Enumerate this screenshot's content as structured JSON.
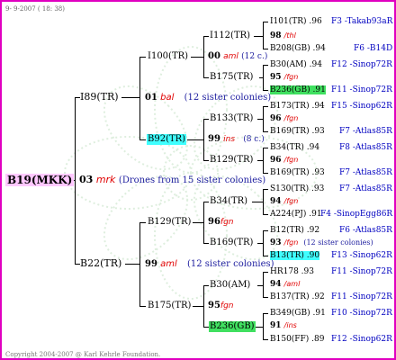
{
  "header": {
    "date": "9- 9-2007 ( 18: 38)"
  },
  "footer": {
    "copyright": "Copyright 2004-2007 @ Karl Kehrle Foundation."
  },
  "root": {
    "id": "B19(MKK)"
  },
  "gen1": [
    {
      "id": "I89(TR)"
    },
    {
      "year": "03",
      "fam": "mrk",
      "note": "(Drones from 15 sister colonies)"
    },
    {
      "id": "B22(TR)"
    }
  ],
  "gen2": [
    {
      "id": "I100(TR)"
    },
    {
      "year": "01",
      "fam": "bal",
      "note": "(12 sister colonies)"
    },
    {
      "id": "B92(TR)"
    },
    {
      "id": "B129(TR)"
    },
    {
      "year": "99",
      "fam": "aml",
      "note": "(12 sister colonies)"
    },
    {
      "id": "B175(TR)"
    }
  ],
  "gen3": [
    {
      "id": "I112(TR)"
    },
    {
      "year": "00",
      "fam": "aml",
      "note": "(12 c.)"
    },
    {
      "id": "B175(TR)"
    },
    {
      "id": "B133(TR)"
    },
    {
      "year": "99",
      "fam": "ins",
      "note": "(8 c.)"
    },
    {
      "id": "B129(TR)"
    },
    {
      "id": "B34(TR)"
    },
    {
      "year": "96",
      "fam": "fgn"
    },
    {
      "id": "B169(TR)"
    },
    {
      "id": "B30(AM)"
    },
    {
      "year": "95",
      "fam": "fgn"
    },
    {
      "id": "B236(GB)"
    }
  ],
  "gen4": [
    {
      "id": "I101(TR)",
      "score": ".96",
      "ped": "F3 -Takab93aR"
    },
    {
      "year": "98",
      "fam": "/thl"
    },
    {
      "id": "B208(GB)",
      "score": ".94",
      "ped": "F6 -B14D"
    },
    {
      "id": "B30(AM)",
      "score": ".94",
      "ped": "F12 -Sinop72R"
    },
    {
      "year": "95",
      "fam": "/fgn"
    },
    {
      "id": "B236(GB)",
      "score": ".91",
      "ped": "F11 -Sinop72R"
    },
    {
      "id": "B173(TR)",
      "score": ".94",
      "ped": "F15 -Sinop62R"
    },
    {
      "year": "96",
      "fam": "/fgn"
    },
    {
      "id": "B169(TR)",
      "score": ".93",
      "ped": "F7 -Atlas85R"
    },
    {
      "id": "B34(TR)",
      "score": ".94",
      "ped": "F8 -Atlas85R"
    },
    {
      "year": "96",
      "fam": "/fgn"
    },
    {
      "id": "B169(TR)",
      "score": ".93",
      "ped": "F7 -Atlas85R"
    },
    {
      "id": "S130(TR)",
      "score": ".93",
      "ped": "F7 -Atlas85R"
    },
    {
      "year": "94",
      "fam": "/fgn"
    },
    {
      "id": "A224(PJ)",
      "score": ".91",
      "ped": "F4 -SinopEgg86R"
    },
    {
      "id": "B12(TR)",
      "score": ".92",
      "ped": "F6 -Atlas85R"
    },
    {
      "year": "93",
      "fam": "/fgn",
      "note": "(12 sister colonies)"
    },
    {
      "id": "B13(TR)",
      "score": ".90",
      "ped": "F13 -Sinop62R"
    },
    {
      "id": "HR178",
      "score": ".93",
      "ped": "F11 -Sinop72R"
    },
    {
      "year": "94",
      "fam": "/aml"
    },
    {
      "id": "B137(TR)",
      "score": ".92",
      "ped": "F11 -Sinop72R"
    },
    {
      "id": "B349(GB)",
      "score": ".91",
      "ped": "F10 -Sinop72R"
    },
    {
      "year": "91",
      "fam": "/ins"
    },
    {
      "id": "B150(FF)",
      "score": ".89",
      "ped": "F12 -Sinop62R"
    }
  ]
}
